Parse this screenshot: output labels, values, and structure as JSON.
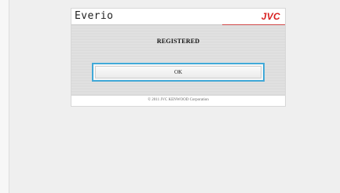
{
  "header": {
    "brand": "Everio",
    "logo": "JVC"
  },
  "main": {
    "status": "REGISTERED",
    "ok_label": "OK"
  },
  "footer": {
    "copyright": "© 2011 JVC KENWOOD Corporation"
  },
  "colors": {
    "background": "#efefef",
    "panel": "#ffffff",
    "focus": "#41a9d8",
    "logo": "#d81f1f"
  }
}
